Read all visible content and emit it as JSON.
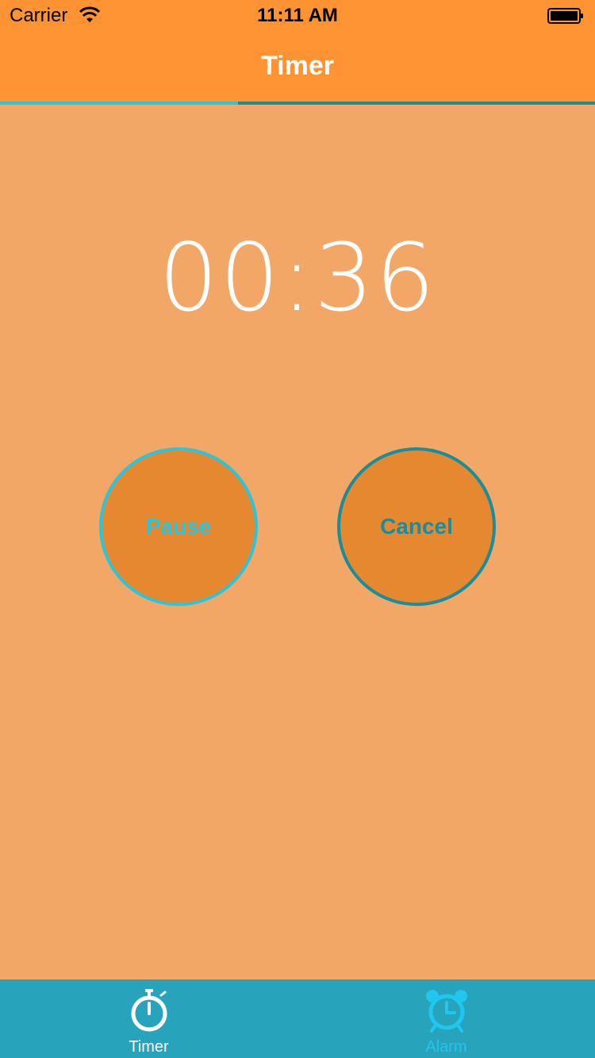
{
  "status_bar": {
    "carrier": "Carrier",
    "time": "11:11 AM",
    "wifi_icon": "wifi-icon",
    "battery_icon": "battery-icon"
  },
  "nav": {
    "title": "Timer"
  },
  "timer": {
    "display": "00:36"
  },
  "controls": {
    "pause_label": "Pause",
    "cancel_label": "Cancel"
  },
  "tab_bar": {
    "items": [
      {
        "label": "Timer",
        "icon": "stopwatch-icon",
        "selected": true
      },
      {
        "label": "Alarm",
        "icon": "alarm-clock-icon",
        "selected": false
      }
    ]
  },
  "colors": {
    "background": "#F2A766",
    "header": "#FD9333",
    "button_fill": "#E58830",
    "accent_light": "#2CC4DA",
    "accent_dark": "#168E9F",
    "tab_bar": "#27A3BC",
    "alarm_tab": "#1FC6EE"
  }
}
